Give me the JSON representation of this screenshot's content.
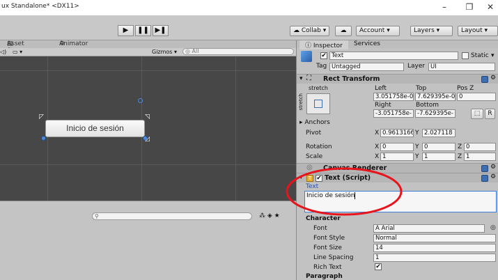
{
  "window": {
    "title": "ux Standalone* <DX11>",
    "minimize": "–",
    "restore": "❐",
    "close": "✕"
  },
  "toolbar": {
    "play": "▶",
    "pause": "❚❚",
    "step": "▶❚",
    "collab": "Collab ▾",
    "account": "Account",
    "layers": "Layers",
    "layout": "Layout"
  },
  "scene": {
    "tabs": [
      "Asset Store",
      "Animator"
    ],
    "gizmos": "Gizmos ▾",
    "search_placeholder": "All",
    "button_text": "Inicio de sesión"
  },
  "inspector": {
    "tabs": [
      "Inspector",
      "Services"
    ],
    "object_name": "Text",
    "static_label": "Static",
    "tag_label": "Tag",
    "tag_value": "Untagged",
    "layer_label": "Layer",
    "layer_value": "UI",
    "rect_transform": {
      "title": "Rect Transform",
      "stretch_top": "stretch",
      "stretch_side": "stretch",
      "left_label": "Left",
      "top_label": "Top",
      "posz_label": "Pos Z",
      "left_value": "3.051758e-0",
      "top_value": "7.629395e-0",
      "posz_value": "0",
      "right_label": "Right",
      "bottom_label": "Bottom",
      "right_value": "-3.051758e-",
      "bottom_value": "-7.629395e-",
      "r_button": "R",
      "anchors": "Anchors",
      "pivot_label": "Pivot",
      "pivot_x": "0.9613166",
      "pivot_y": "2.027118",
      "rotation_label": "Rotation",
      "rotation_x": "0",
      "rotation_y": "0",
      "rotation_z": "0",
      "scale_label": "Scale",
      "scale_x": "1",
      "scale_y": "1",
      "scale_z": "1",
      "x": "X",
      "y": "Y",
      "z": "Z"
    },
    "canvas_renderer": "Canvas Renderer",
    "text_script": {
      "title": "Text (Script)",
      "text_label": "Text",
      "text_value": "Inicio de sesión",
      "character_label": "Character",
      "font_label": "Font",
      "font_value": "Arial",
      "font_style_label": "Font Style",
      "font_style_value": "Normal",
      "font_size_label": "Font Size",
      "font_size_value": "14",
      "line_spacing_label": "Line Spacing",
      "line_spacing_value": "1",
      "rich_text_label": "Rich Text",
      "rich_text_check": "✔",
      "paragraph_label": "Paragraph"
    }
  },
  "colors": {
    "annotation_circle": "#e8141c",
    "selection_blue": "#3d7bd9",
    "scene_bg": "#474747"
  }
}
